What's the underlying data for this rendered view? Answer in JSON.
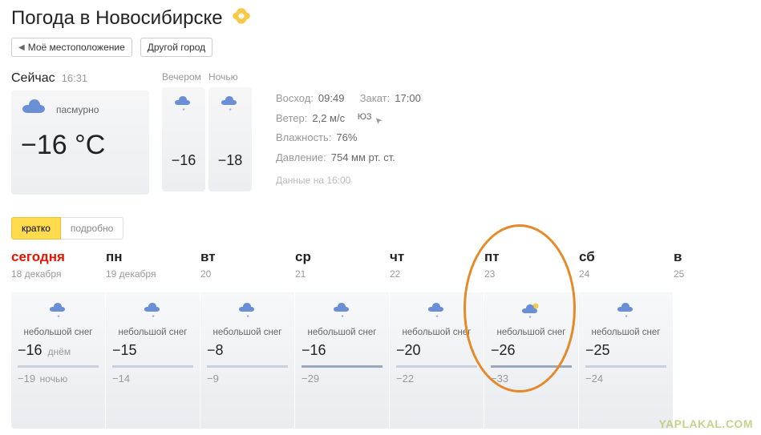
{
  "title": "Погода в Новосибирске",
  "buttons": {
    "my_location": "Моё местоположение",
    "other_city": "Другой город"
  },
  "now": {
    "label": "Сейчас",
    "time": "16:31",
    "condition": "пасмурно",
    "temp": "−16 °С",
    "parts": {
      "evening_label": "Вечером",
      "night_label": "Ночью",
      "evening_temp": "−16",
      "night_temp": "−18"
    }
  },
  "details": {
    "sunrise_label": "Восход:",
    "sunrise": "09:49",
    "sunset_label": "Закат:",
    "sunset": "17:00",
    "wind_label": "Ветер:",
    "wind": "2,2 м/с",
    "wind_dir": "ЮЗ",
    "humidity_label": "Влажность:",
    "humidity": "76%",
    "pressure_label": "Давление:",
    "pressure": "754 мм рт. ст.",
    "data_asof": "Данные на 16:00"
  },
  "tabs": {
    "brief": "кратко",
    "detailed": "подробно"
  },
  "forecast": [
    {
      "dow": "сегодня",
      "date": "18 декабря",
      "cond": "небольшой снег",
      "hi": "−16",
      "hi_suffix": "днём",
      "lo": "−19",
      "lo_suffix": "ночью",
      "today": true,
      "night_dark": false,
      "icon": "snow"
    },
    {
      "dow": "пн",
      "date": "19 декабря",
      "cond": "небольшой снег",
      "hi": "−15",
      "hi_suffix": "",
      "lo": "−14",
      "lo_suffix": "",
      "today": false,
      "night_dark": false,
      "icon": "snow"
    },
    {
      "dow": "вт",
      "date": "20",
      "cond": "небольшой снег",
      "hi": "−8",
      "hi_suffix": "",
      "lo": "−9",
      "lo_suffix": "",
      "today": false,
      "night_dark": false,
      "icon": "snow"
    },
    {
      "dow": "ср",
      "date": "21",
      "cond": "небольшой снег",
      "hi": "−16",
      "hi_suffix": "",
      "lo": "−29",
      "lo_suffix": "",
      "today": false,
      "night_dark": true,
      "icon": "snow"
    },
    {
      "dow": "чт",
      "date": "22",
      "cond": "небольшой снег",
      "hi": "−20",
      "hi_suffix": "",
      "lo": "−22",
      "lo_suffix": "",
      "today": false,
      "night_dark": false,
      "icon": "snow"
    },
    {
      "dow": "пт",
      "date": "23",
      "cond": "небольшой снег",
      "hi": "−26",
      "hi_suffix": "",
      "lo": "−33",
      "lo_suffix": "",
      "today": false,
      "night_dark": true,
      "icon": "sun-snow"
    },
    {
      "dow": "сб",
      "date": "24",
      "cond": "небольшой снег",
      "hi": "−25",
      "hi_suffix": "",
      "lo": "−24",
      "lo_suffix": "",
      "today": false,
      "night_dark": false,
      "icon": "snow"
    },
    {
      "dow": "в",
      "date": "25",
      "cond": "",
      "hi": "",
      "hi_suffix": "",
      "lo": "",
      "lo_suffix": "",
      "today": false,
      "night_dark": false,
      "icon": "",
      "partial": true
    }
  ],
  "watermark": "YAPLAKAL.COM"
}
